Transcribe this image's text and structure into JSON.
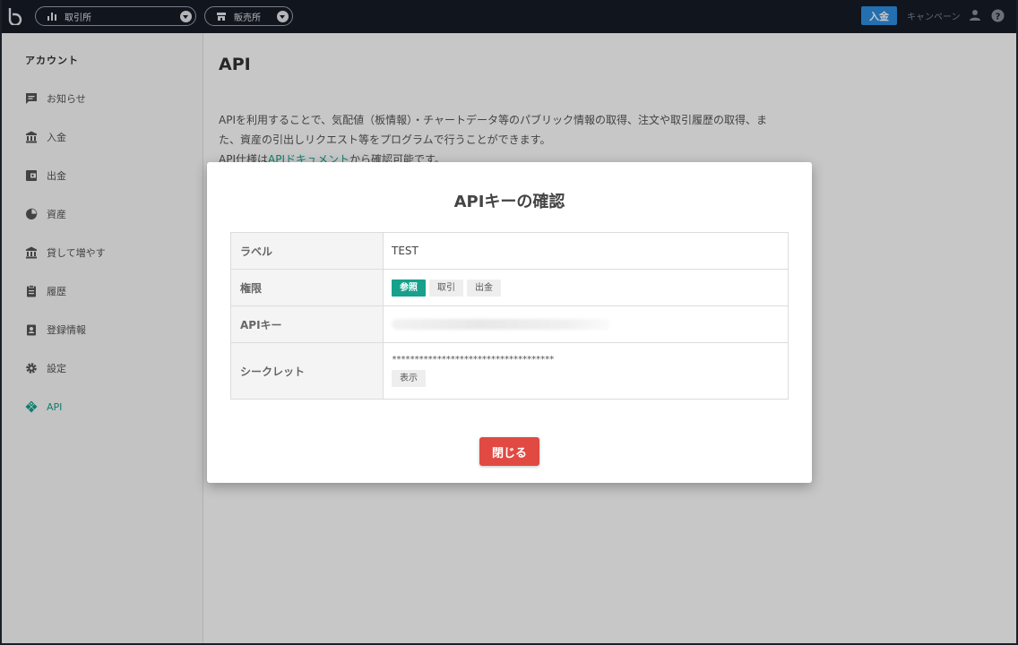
{
  "header": {
    "exchange_label": "取引所",
    "store_label": "販売所",
    "deposit_label": "入金",
    "campaign_label": "キャンペーン"
  },
  "sidebar": {
    "title": "アカウント",
    "items": [
      {
        "label": "お知らせ",
        "icon": "message-icon"
      },
      {
        "label": "入金",
        "icon": "bank-icon"
      },
      {
        "label": "出金",
        "icon": "wallet-icon"
      },
      {
        "label": "資産",
        "icon": "pie-chart-icon"
      },
      {
        "label": "貸して増やす",
        "icon": "bank-icon"
      },
      {
        "label": "履歴",
        "icon": "clipboard-icon"
      },
      {
        "label": "登録情報",
        "icon": "badge-icon"
      },
      {
        "label": "設定",
        "icon": "gear-icon"
      },
      {
        "label": "API",
        "icon": "api-icon",
        "active": true
      }
    ]
  },
  "main": {
    "title": "API",
    "desc_line1": "APIを利用することで、気配値（板情報）・チャートデータ等のパブリック情報の取得、注文や取引履歴の取得、ま",
    "desc_line2": "た、資産の引出しリクエスト等をプログラムで行うことができます。",
    "desc_line3_prefix": "API仕様は",
    "desc_line3_link": "APIドキュメント",
    "desc_line3_suffix": "から確認可能です。"
  },
  "modal": {
    "title": "APIキーの確認",
    "rows": {
      "label": {
        "header": "ラベル",
        "value": "TEST"
      },
      "permission": {
        "header": "権限",
        "tags": [
          "参照",
          "取引",
          "出金"
        ],
        "active_tag": "参照"
      },
      "api_key": {
        "header": "APIキー"
      },
      "secret": {
        "header": "シークレット",
        "value": "************************************",
        "show_label": "表示"
      }
    },
    "close_label": "閉じる"
  },
  "colors": {
    "accent": "#17a08c",
    "deposit": "#2d8fe0",
    "close": "#e04a42",
    "topbar": "#171b26"
  }
}
